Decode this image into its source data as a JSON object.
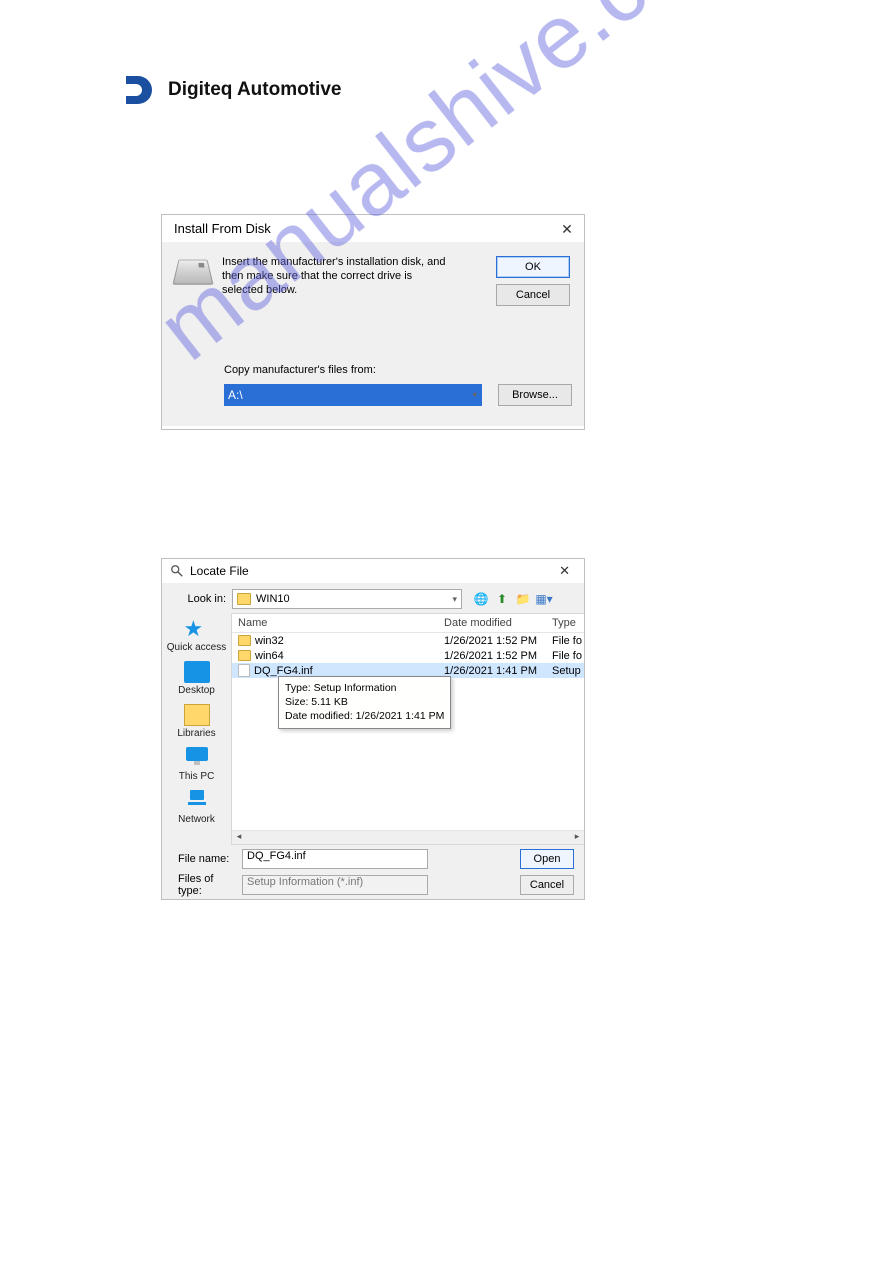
{
  "brand": {
    "name": "Digiteq Automotive"
  },
  "watermark": "manualshive.com",
  "dialog1": {
    "title": "Install From Disk",
    "instruction": "Insert the manufacturer's installation disk, and then make sure that the correct drive is selected below.",
    "ok": "OK",
    "cancel": "Cancel",
    "copy_label": "Copy manufacturer's files from:",
    "path_value": "A:\\",
    "browse": "Browse..."
  },
  "dialog2": {
    "title": "Locate File",
    "lookin_label": "Look in:",
    "lookin_value": "WIN10",
    "places": {
      "quick": "Quick access",
      "desktop": "Desktop",
      "libraries": "Libraries",
      "thispc": "This PC",
      "network": "Network"
    },
    "columns": {
      "name": "Name",
      "date": "Date modified",
      "type": "Type"
    },
    "rows": [
      {
        "name": "win32",
        "date": "1/26/2021 1:52 PM",
        "type": "File fo",
        "kind": "folder"
      },
      {
        "name": "win64",
        "date": "1/26/2021 1:52 PM",
        "type": "File fo",
        "kind": "folder"
      },
      {
        "name": "DQ_FG4.inf",
        "date": "1/26/2021 1:41 PM",
        "type": "Setup",
        "kind": "file",
        "selected": true
      }
    ],
    "tooltip": {
      "l1": "Type: Setup Information",
      "l2": "Size: 5.11 KB",
      "l3": "Date modified: 1/26/2021 1:41 PM"
    },
    "filename_label": "File name:",
    "filename_value": "DQ_FG4.inf",
    "filetype_label": "Files of type:",
    "filetype_value": "Setup Information (*.inf)",
    "open": "Open",
    "cancel": "Cancel"
  }
}
